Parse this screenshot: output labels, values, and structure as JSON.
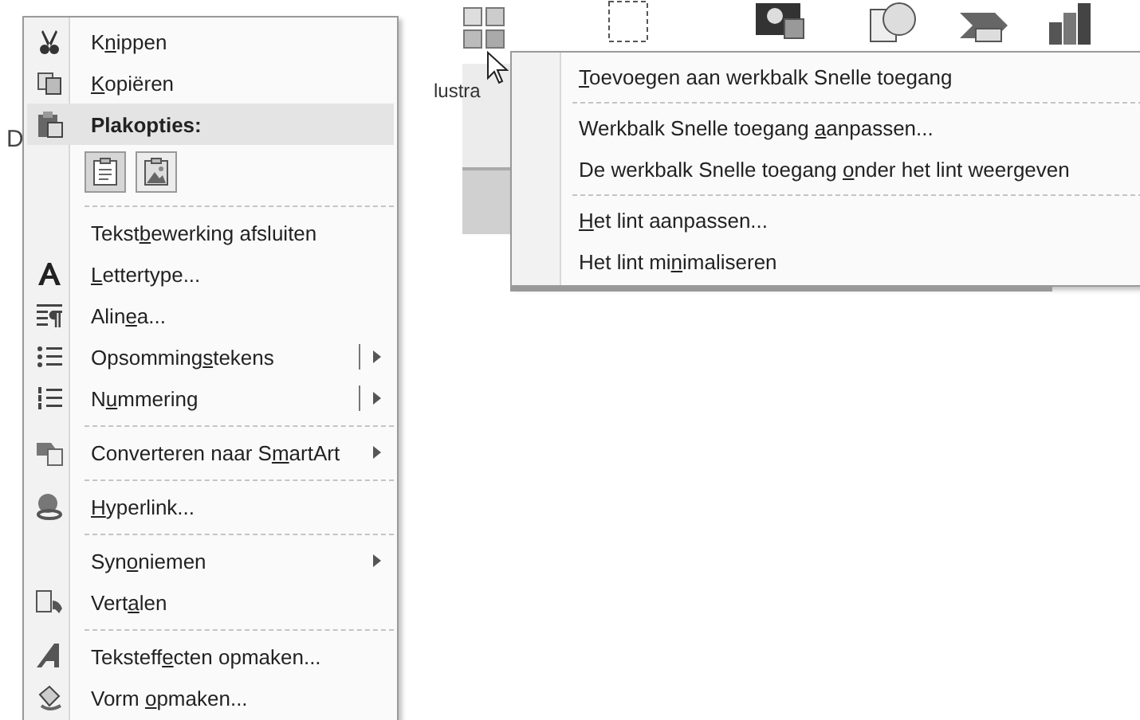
{
  "left_menu": {
    "background_text": "D",
    "items": [
      {
        "kind": "item",
        "parts": {
          "before": "K",
          "key": "n",
          "after": "ippen"
        }
      },
      {
        "kind": "item",
        "parts": {
          "key": "K",
          "after": "opiëren"
        }
      },
      {
        "kind": "header",
        "parts": {
          "before": "Plakopties:"
        }
      },
      {
        "kind": "paste_options",
        "buttons": [
          {
            "selected": true
          },
          {
            "selected": false
          }
        ]
      },
      {
        "kind": "separator"
      },
      {
        "kind": "item",
        "parts": {
          "before": "Tekst",
          "key": "b",
          "after": "ewerking afsluiten"
        }
      },
      {
        "kind": "item",
        "parts": {
          "key": "L",
          "after": "ettertype..."
        }
      },
      {
        "kind": "item",
        "parts": {
          "before": "Alin",
          "key": "e",
          "after": "a..."
        }
      },
      {
        "kind": "item",
        "parts": {
          "before": "Opsomming",
          "key": "s",
          "after": "tekens"
        },
        "submenu": true,
        "split": true
      },
      {
        "kind": "item",
        "parts": {
          "before": "N",
          "key": "u",
          "after": "mmering"
        },
        "submenu": true,
        "split": true
      },
      {
        "kind": "separator"
      },
      {
        "kind": "item",
        "parts": {
          "before": "Converteren naar S",
          "key": "m",
          "after": "artArt"
        },
        "submenu": true,
        "split": false
      },
      {
        "kind": "separator"
      },
      {
        "kind": "item",
        "parts": {
          "key": "H",
          "after": "yperlink..."
        }
      },
      {
        "kind": "separator"
      },
      {
        "kind": "item",
        "parts": {
          "before": "Syn",
          "key": "o",
          "after": "niemen"
        },
        "submenu": true,
        "split": false
      },
      {
        "kind": "item",
        "parts": {
          "before": "Vert",
          "key": "a",
          "after": "len"
        }
      },
      {
        "kind": "separator"
      },
      {
        "kind": "item",
        "parts": {
          "before": "Teksteff",
          "key": "e",
          "after": "cten opmaken..."
        }
      },
      {
        "kind": "item",
        "parts": {
          "before": "Vorm ",
          "key": "o",
          "after": "pmaken..."
        }
      }
    ]
  },
  "ribbon": {
    "group_label": "lustra"
  },
  "right_menu": {
    "items": [
      {
        "kind": "item",
        "parts": {
          "key": "T",
          "after": "oevoegen aan werkbalk Snelle toegang"
        }
      },
      {
        "kind": "separator"
      },
      {
        "kind": "item",
        "parts": {
          "before": "Werkbalk Snelle toegang ",
          "key": "a",
          "after": "anpassen..."
        }
      },
      {
        "kind": "item",
        "parts": {
          "before": "De werkbalk Snelle toegang ",
          "key": "o",
          "after": "nder het lint weergeven"
        }
      },
      {
        "kind": "separator"
      },
      {
        "kind": "item",
        "parts": {
          "key": "H",
          "after": "et lint aanpassen..."
        }
      },
      {
        "kind": "item",
        "parts": {
          "before": "Het lint mi",
          "key": "n",
          "after": "imaliseren"
        }
      }
    ]
  }
}
